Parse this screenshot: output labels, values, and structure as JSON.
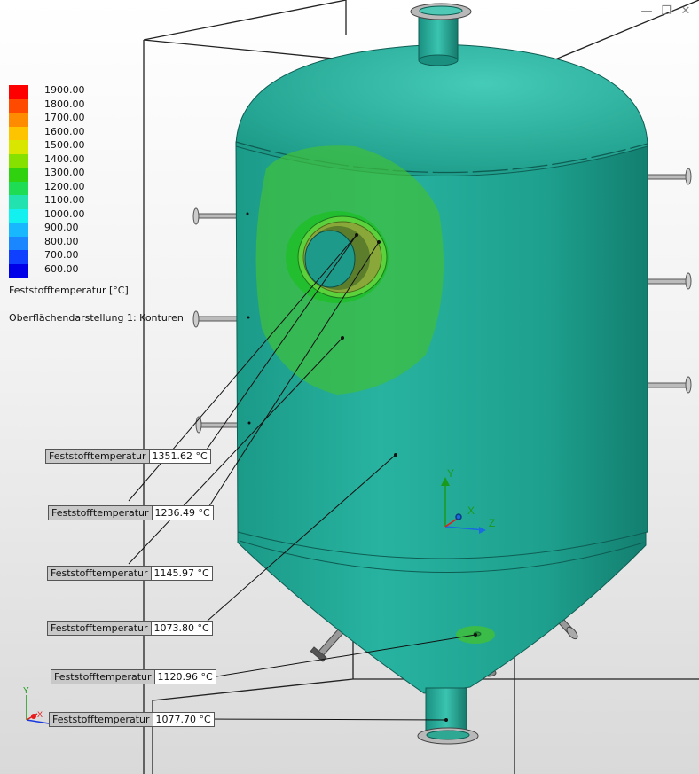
{
  "legend": {
    "labels": [
      "1900.00",
      "1800.00",
      "1700.00",
      "1600.00",
      "1500.00",
      "1400.00",
      "1300.00",
      "1200.00",
      "1100.00",
      "1000.00",
      "900.00",
      "800.00",
      "700.00",
      "600.00"
    ],
    "colors": [
      "#ff0000",
      "#ff4a00",
      "#ff8c00",
      "#ffc400",
      "#d8e600",
      "#86e000",
      "#30d20f",
      "#1fdc55",
      "#22e3b0",
      "#12f0f0",
      "#18b8ff",
      "#1a86ff",
      "#1040ff",
      "#0000e8"
    ],
    "title": "Feststofftemperatur [°C]",
    "display": "Oberflächendarstellung 1: Konturen"
  },
  "probes": [
    {
      "name": "Feststofftemperatur",
      "value": "1351.62 °C"
    },
    {
      "name": "Feststofftemperatur",
      "value": "1236.49 °C"
    },
    {
      "name": "Feststofftemperatur",
      "value": "1145.97 °C"
    },
    {
      "name": "Feststofftemperatur",
      "value": "1073.80 °C"
    },
    {
      "name": "Feststofftemperatur",
      "value": "1120.96 °C"
    },
    {
      "name": "Feststofftemperatur",
      "value": "1077.70 °C"
    }
  ],
  "triad": {
    "x": "X",
    "y": "Y",
    "z": "Z"
  },
  "colors": {
    "vessel": "#21a896",
    "vessel_dark": "#127a6c",
    "hot_zone": "#3fbf3c"
  }
}
